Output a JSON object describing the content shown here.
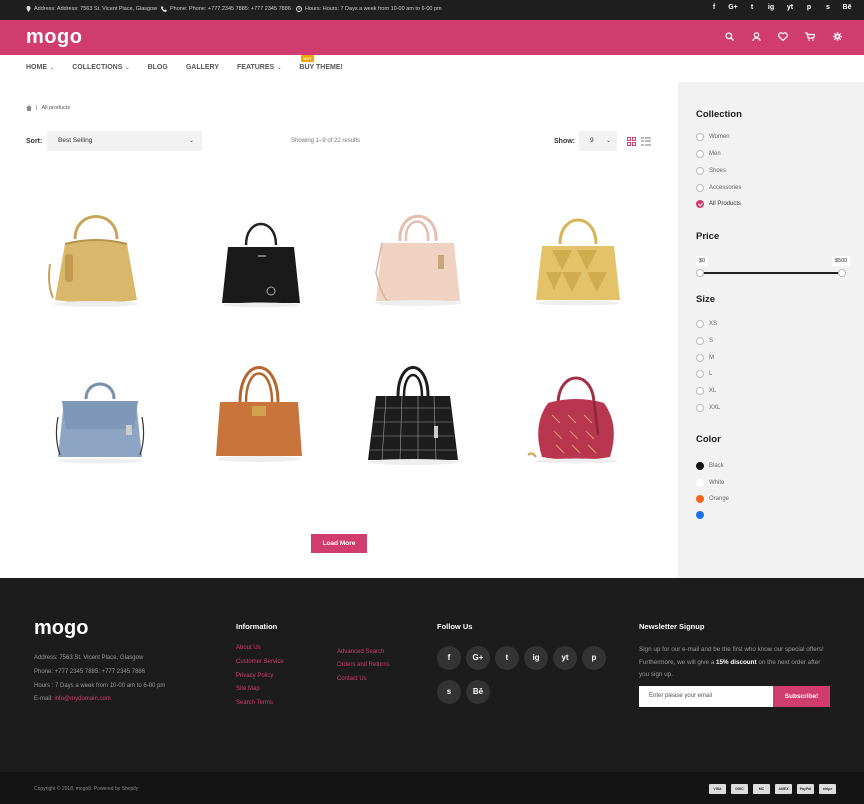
{
  "topbar": {
    "address": "Address: Address: 7563 St. Vicent Place, Glasgow",
    "phone": "Phone: Phone: +777 2345 7885: +777 2345 7886",
    "hours": "Hours: Hours: 7 Days a week from 10-00 am to 6-00 pm",
    "social": [
      "f",
      "G+",
      "t",
      "ig",
      "yt",
      "p",
      "s",
      "Bē"
    ]
  },
  "header": {
    "logo": "mogo",
    "icons": [
      "search-icon",
      "user-icon",
      "heart-icon",
      "cart-icon",
      "gear-icon"
    ]
  },
  "nav": [
    {
      "label": "HOME",
      "has_menu": true
    },
    {
      "label": "COLLECTIONS",
      "has_menu": true
    },
    {
      "label": "BLOG",
      "has_menu": false
    },
    {
      "label": "GALLERY",
      "has_menu": false
    },
    {
      "label": "FEATURES",
      "has_menu": true
    },
    {
      "label": "BUY THEME!",
      "has_menu": false,
      "badge": "HOT"
    }
  ],
  "breadcrumb": {
    "current": "All products"
  },
  "toolbar": {
    "sort_label": "Sort:",
    "sort_value": "Best Selling",
    "showing": "Showing 1–9 of 22 results",
    "show_label": "Show:",
    "show_value": "9"
  },
  "products": [
    {
      "name": "gold-tote",
      "color": "#d9b86c"
    },
    {
      "name": "black-tote",
      "color": "#1a1a1a"
    },
    {
      "name": "blush-satchel",
      "color": "#f0d2c2"
    },
    {
      "name": "gold-pattern-tote",
      "color": "#e3c26a"
    },
    {
      "name": "blue-satchel",
      "color": "#8da5c3"
    },
    {
      "name": "orange-tote",
      "color": "#c8743a"
    },
    {
      "name": "black-pattern-tote",
      "color": "#1d1d1d"
    },
    {
      "name": "red-hobo",
      "color": "#b8374f"
    }
  ],
  "load_more": "Load More",
  "sidebar": {
    "collection_title": "Collection",
    "collections": [
      {
        "label": "Women",
        "checked": false
      },
      {
        "label": "Men",
        "checked": false
      },
      {
        "label": "Shoes",
        "checked": false
      },
      {
        "label": "Accessories",
        "checked": false
      },
      {
        "label": "All Products",
        "checked": true
      }
    ],
    "price_title": "Price",
    "price_min": "$0",
    "price_max": "$500",
    "size_title": "Size",
    "sizes": [
      "XS",
      "S",
      "M",
      "L",
      "XL",
      "XXL"
    ],
    "color_title": "Color",
    "colors": [
      {
        "label": "Black",
        "hex": "#111111"
      },
      {
        "label": "White",
        "hex": "#ffffff"
      },
      {
        "label": "Orange",
        "hex": "#f26522"
      }
    ]
  },
  "footer": {
    "logo": "mogo",
    "address": "Address: 7563 St. Vicent Place, Glasgow",
    "phone": "Phone: +777 2345 7885: +777 2345 7886",
    "hours": "Hours : 7 Days a week from 10-00 am to 6-00 pm",
    "email_label": "E-mail:",
    "email": "info@mydomain.com",
    "info_title": "Information",
    "info_links_col1": [
      "About Us",
      "Customer Service",
      "Privacy Policy",
      "Site Map",
      "Search Terms"
    ],
    "info_links_col2": [
      "Advanced Search",
      "Orders and Returns",
      "Contact Us"
    ],
    "follow_title": "Follow Us",
    "follow_icons": [
      "f",
      "G+",
      "t",
      "ig",
      "yt",
      "p",
      "s",
      "Bē"
    ],
    "newsletter_title": "Newsletter Signup",
    "newsletter_text_1": "Sign up for our e-mail and be the first who know our special offers! Furthermore, we will give a",
    "newsletter_bold": "15% discount",
    "newsletter_text_2": "on the next order after you sign up.",
    "email_placeholder": "Enter please your email",
    "subscribe": "Subscribe!",
    "copyright": "Copyright © 2018, mogo8. Powered by Shopify",
    "payments": [
      "VISA",
      "DISC",
      "MC",
      "AMEX",
      "PayPal",
      "stripe"
    ]
  },
  "colors": {
    "accent": "#d13c6f",
    "dark": "#1f1f1f"
  }
}
